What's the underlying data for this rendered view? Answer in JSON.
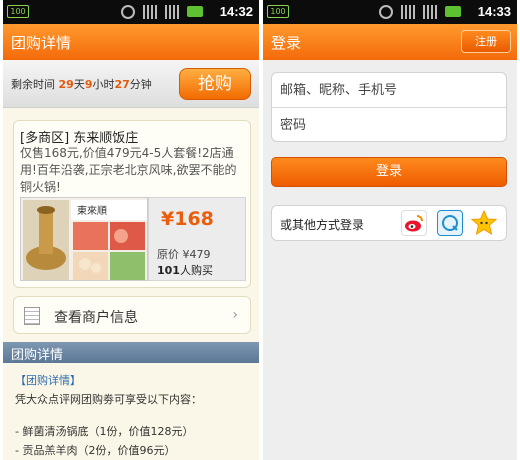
{
  "left": {
    "status": {
      "battery": "100",
      "time": "14:32"
    },
    "title": "团购详情",
    "timer": {
      "label": "剩余时间",
      "days": "29",
      "days_unit": "天",
      "hours": "9",
      "hours_unit": "小时",
      "minutes": "27",
      "minutes_unit": "分钟"
    },
    "grab_button": "抢购",
    "deal": {
      "title": "[多商区] 东来顺饭庄",
      "description": "仅售168元,价值479元4-5人套餐!2店通用!百年沿袭,正宗老北京风味,欲罢不能的铜火锅!",
      "price": "¥168",
      "original_price": "原价 ¥479",
      "sold_count": "101",
      "sold_suffix": "人购买"
    },
    "merchant_label": "查看商户信息",
    "section_header": "团购详情",
    "detail_link": "【团购详情】",
    "detail_intro": "凭大众点评网团购劵可享受以下内容：",
    "detail_items": [
      "- 鲜菌清汤锅底（1份，价值128元）",
      "- 贡品羔羊肉（2份，价值96元）"
    ]
  },
  "right": {
    "status": {
      "battery": "100",
      "time": "14:33"
    },
    "title": "登录",
    "register_button": "注册",
    "account_placeholder": "邮箱、昵称、手机号",
    "password_placeholder": "密码",
    "login_button": "登录",
    "other_login_label": "或其他方式登录",
    "social_icons": [
      "weibo-icon",
      "qq-icon",
      "star-icon"
    ]
  },
  "colors": {
    "accent": "#f46a0a",
    "price": "#e95d0c",
    "section": "#5b7896",
    "link": "#2f6cad"
  }
}
